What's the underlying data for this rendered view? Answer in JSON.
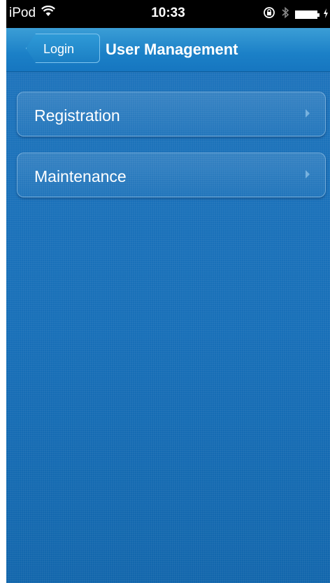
{
  "status_bar": {
    "carrier": "iPod",
    "time": "10:33",
    "icons": [
      "wifi-icon",
      "orientation-lock-icon",
      "bluetooth-icon",
      "battery-icon",
      "charging-icon"
    ]
  },
  "nav_bar": {
    "back_label": "Login",
    "title": "User Management"
  },
  "menu": {
    "items": [
      {
        "label": "Registration"
      },
      {
        "label": "Maintenance"
      }
    ]
  },
  "colors": {
    "background": "#1a6fb6",
    "nav_bar": "#1b80c7",
    "status_bar": "#000000"
  }
}
